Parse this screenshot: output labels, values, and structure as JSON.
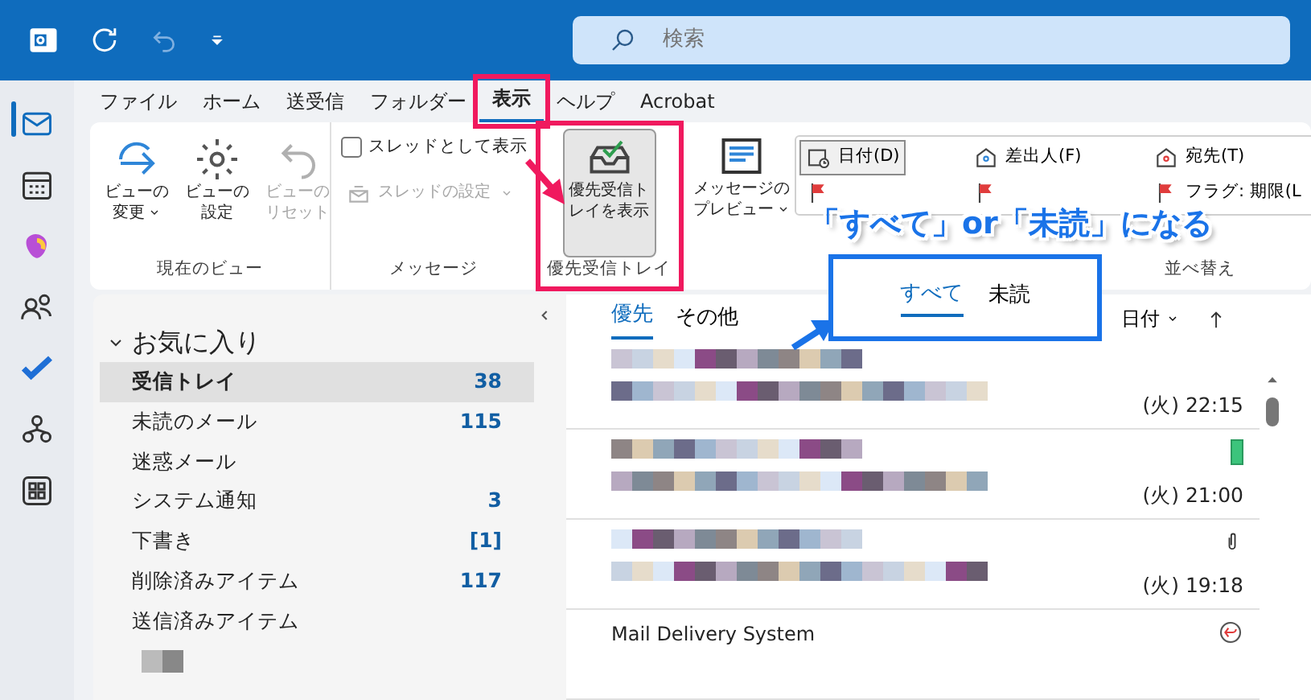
{
  "title_bar": {
    "search": {
      "placeholder": "検索"
    }
  },
  "menu_tabs": [
    {
      "label": "ファイル",
      "selected": false
    },
    {
      "label": "ホーム",
      "selected": false
    },
    {
      "label": "送受信",
      "selected": false
    },
    {
      "label": "フォルダー",
      "selected": false
    },
    {
      "label": "表示",
      "selected": true
    },
    {
      "label": "ヘルプ",
      "selected": false
    },
    {
      "label": "Acrobat",
      "selected": false
    }
  ],
  "ribbon": {
    "current_view": {
      "label": "現在のビュー",
      "buttons": [
        {
          "kind": "change",
          "lines": [
            "ビューの",
            "変更"
          ],
          "has_menu": true,
          "disabled": false
        },
        {
          "kind": "settings",
          "lines": [
            "ビューの",
            "設定"
          ],
          "has_menu": false,
          "disabled": false
        },
        {
          "kind": "reset",
          "lines": [
            "ビューの",
            "リセット"
          ],
          "has_menu": false,
          "disabled": true
        }
      ]
    },
    "messages": {
      "label": "メッセージ",
      "thread_checkbox": {
        "label": "スレッドとして表示",
        "checked": false
      },
      "thread_settings": {
        "label": "スレッドの設定",
        "has_menu": true,
        "disabled": true
      }
    },
    "focused_inbox": {
      "label": "優先受信トレイ",
      "button": {
        "lines": [
          "優先受信ト",
          "レイを表示"
        ],
        "selected": true
      }
    },
    "preview": {
      "lines": [
        "メッセージの",
        "プレビュー"
      ],
      "has_menu": true
    },
    "sort": {
      "label": "並べ替え",
      "options": [
        {
          "kind": "date",
          "label": "日付(D)",
          "selected": true
        },
        {
          "kind": "from",
          "label": "差出人(F)",
          "selected": false
        },
        {
          "kind": "to",
          "label": "宛先(T)",
          "selected": false
        },
        {
          "kind": "flag",
          "selected": false
        },
        {
          "kind": "flag",
          "selected": false
        },
        {
          "kind": "flag",
          "label": "フラグ: 期限(L",
          "selected": false
        }
      ]
    }
  },
  "annotation": {
    "callout_text": "「すべて」or「未読」になる",
    "tabs": [
      {
        "label": "すべて",
        "selected": true
      },
      {
        "label": "未読",
        "selected": false
      }
    ]
  },
  "folders": {
    "heading": "お気に入り",
    "expanded": true,
    "items": [
      {
        "name": "受信トレイ",
        "count": "38",
        "selected": true
      },
      {
        "name": "未読のメール",
        "count": "115",
        "selected": false
      },
      {
        "name": "迷惑メール",
        "selected": false
      },
      {
        "name": "システム通知",
        "count": "3",
        "selected": false
      },
      {
        "name": "下書き",
        "count": "[1]",
        "selected": false
      },
      {
        "name": "削除済みアイテム",
        "count": "117",
        "selected": false
      },
      {
        "name": "送信済みアイテム",
        "selected": false
      }
    ]
  },
  "message_list": {
    "tabs": [
      {
        "label": "優先",
        "selected": true
      },
      {
        "label": "その他",
        "selected": false
      }
    ],
    "sort_label": "日付",
    "messages": [
      {
        "time": "(火) 22:15",
        "kind": "plain"
      },
      {
        "time": "(火) 21:00",
        "kind": "category",
        "color": "#3cc47c"
      },
      {
        "time": "(火) 19:18",
        "kind": "attachment"
      },
      {
        "sender": "Mail Delivery System",
        "kind": "reply"
      }
    ]
  }
}
